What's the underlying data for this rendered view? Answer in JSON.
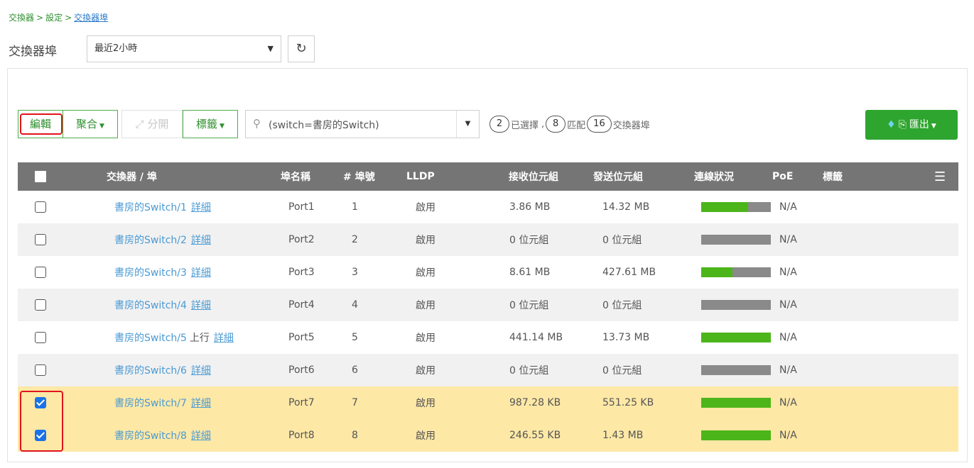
{
  "breadcrumb": {
    "item1": "交換器",
    "sep1": ">",
    "item2": "設定",
    "sep2": ">",
    "current": "交換器埠"
  },
  "page": {
    "title": "交換器埠",
    "time_range": "最近2小時",
    "refresh_icon": "refresh-icon"
  },
  "toolbar": {
    "edit_label": "編輯",
    "aggregate_label": "聚合",
    "split_label": "分開",
    "tags_label": "標籤",
    "search_value": "(switch=書房的Switch)",
    "selected_count": "2",
    "selected_text": "已選擇",
    "comma": ",",
    "matched_count": "8",
    "matched_text": "匹配",
    "total_count": "16",
    "total_text": "交換器埠",
    "export_label": "匯出"
  },
  "table": {
    "headers": {
      "switch_port": "交換器 / 埠",
      "port_name": "埠名稱",
      "port_no": "# 埠號",
      "lldp": "LLDP",
      "rx": "接收位元組",
      "tx": "發送位元組",
      "status": "連線狀況",
      "poe": "PoE",
      "tags": "標籤"
    },
    "detail_label": "詳細",
    "rows": [
      {
        "name": "書房的Switch/1",
        "extra": "",
        "port_name": "Port1",
        "port_no": "1",
        "lldp": "啟用",
        "rx": "3.86 MB",
        "tx": "14.32 MB",
        "status_fill": 0.67,
        "poe": "N/A",
        "checked": false
      },
      {
        "name": "書房的Switch/2",
        "extra": "",
        "port_name": "Port2",
        "port_no": "2",
        "lldp": "啟用",
        "rx": "0 位元組",
        "tx": "0 位元組",
        "status_fill": 0,
        "poe": "N/A",
        "checked": false
      },
      {
        "name": "書房的Switch/3",
        "extra": "",
        "port_name": "Port3",
        "port_no": "3",
        "lldp": "啟用",
        "rx": "8.61 MB",
        "tx": "427.61 MB",
        "status_fill": 0.45,
        "poe": "N/A",
        "checked": false
      },
      {
        "name": "書房的Switch/4",
        "extra": "",
        "port_name": "Port4",
        "port_no": "4",
        "lldp": "啟用",
        "rx": "0 位元組",
        "tx": "0 位元組",
        "status_fill": 0,
        "poe": "N/A",
        "checked": false
      },
      {
        "name": "書房的Switch/5",
        "extra": "上行",
        "port_name": "Port5",
        "port_no": "5",
        "lldp": "啟用",
        "rx": "441.14 MB",
        "tx": "13.73 MB",
        "status_fill": 1,
        "poe": "N/A",
        "checked": false
      },
      {
        "name": "書房的Switch/6",
        "extra": "",
        "port_name": "Port6",
        "port_no": "6",
        "lldp": "啟用",
        "rx": "0 位元組",
        "tx": "0 位元組",
        "status_fill": 0,
        "poe": "N/A",
        "checked": false
      },
      {
        "name": "書房的Switch/7",
        "extra": "",
        "port_name": "Port7",
        "port_no": "7",
        "lldp": "啟用",
        "rx": "987.28 KB",
        "tx": "551.25 KB",
        "status_fill": 1,
        "poe": "N/A",
        "checked": true
      },
      {
        "name": "書房的Switch/8",
        "extra": "",
        "port_name": "Port8",
        "port_no": "8",
        "lldp": "啟用",
        "rx": "246.55 KB",
        "tx": "1.43 MB",
        "status_fill": 1,
        "poe": "N/A",
        "checked": true
      }
    ]
  },
  "colors": {
    "accent_green": "#2ea52e",
    "link_blue": "#4a9ad4",
    "selected_row": "#fde8a6",
    "status_green": "#4cb51a",
    "status_gray": "#8a8a8a",
    "highlight_red": "#e0141b"
  }
}
